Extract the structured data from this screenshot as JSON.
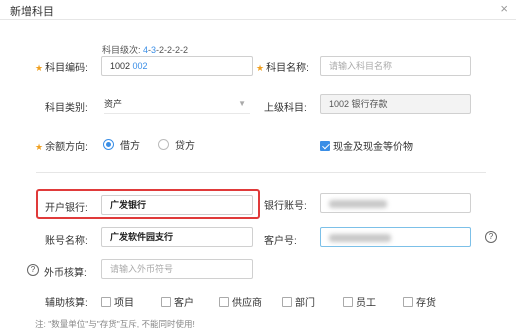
{
  "dialog": {
    "title": "新增科目",
    "close": "×"
  },
  "level_hint": {
    "prefix": "科目级次: ",
    "first": "4",
    "sep1": "-",
    "highlight": "3",
    "rest": "-2-2-2-2"
  },
  "code": {
    "label": "科目编码:",
    "prefix": "1002",
    "suffix": "002"
  },
  "name": {
    "label": "科目名称:",
    "placeholder": "请输入科目名称"
  },
  "category": {
    "label": "科目类别:",
    "value": "资产"
  },
  "parent": {
    "label": "上级科目:",
    "value": "1002 银行存款"
  },
  "balance": {
    "label": "余额方向:",
    "debit": "借方",
    "credit": "贷方"
  },
  "cash": {
    "label": "现金及现金等价物"
  },
  "bank_open": {
    "label": "开户银行:",
    "value": "广发银行"
  },
  "bank_account": {
    "label": "银行账号:"
  },
  "account_name": {
    "label": "账号名称:",
    "value": "广发软件园支行"
  },
  "customer_no": {
    "label": "客户号:"
  },
  "currency": {
    "label": "外币核算:",
    "placeholder": "请输入外币符号"
  },
  "aux": {
    "label": "辅助核算:",
    "items": [
      "项目",
      "客户",
      "供应商",
      "部门",
      "员工",
      "存货"
    ]
  },
  "note": "注: \"数量单位\"与\"存货\"互斥, 不能同时使用!",
  "colors": {
    "accent": "#3a8ee6",
    "required": "#f0a020",
    "highlight": "#e03a3a"
  },
  "icons": {
    "help": "question-circle-icon",
    "close": "close-icon",
    "caret": "caret-down-icon"
  }
}
